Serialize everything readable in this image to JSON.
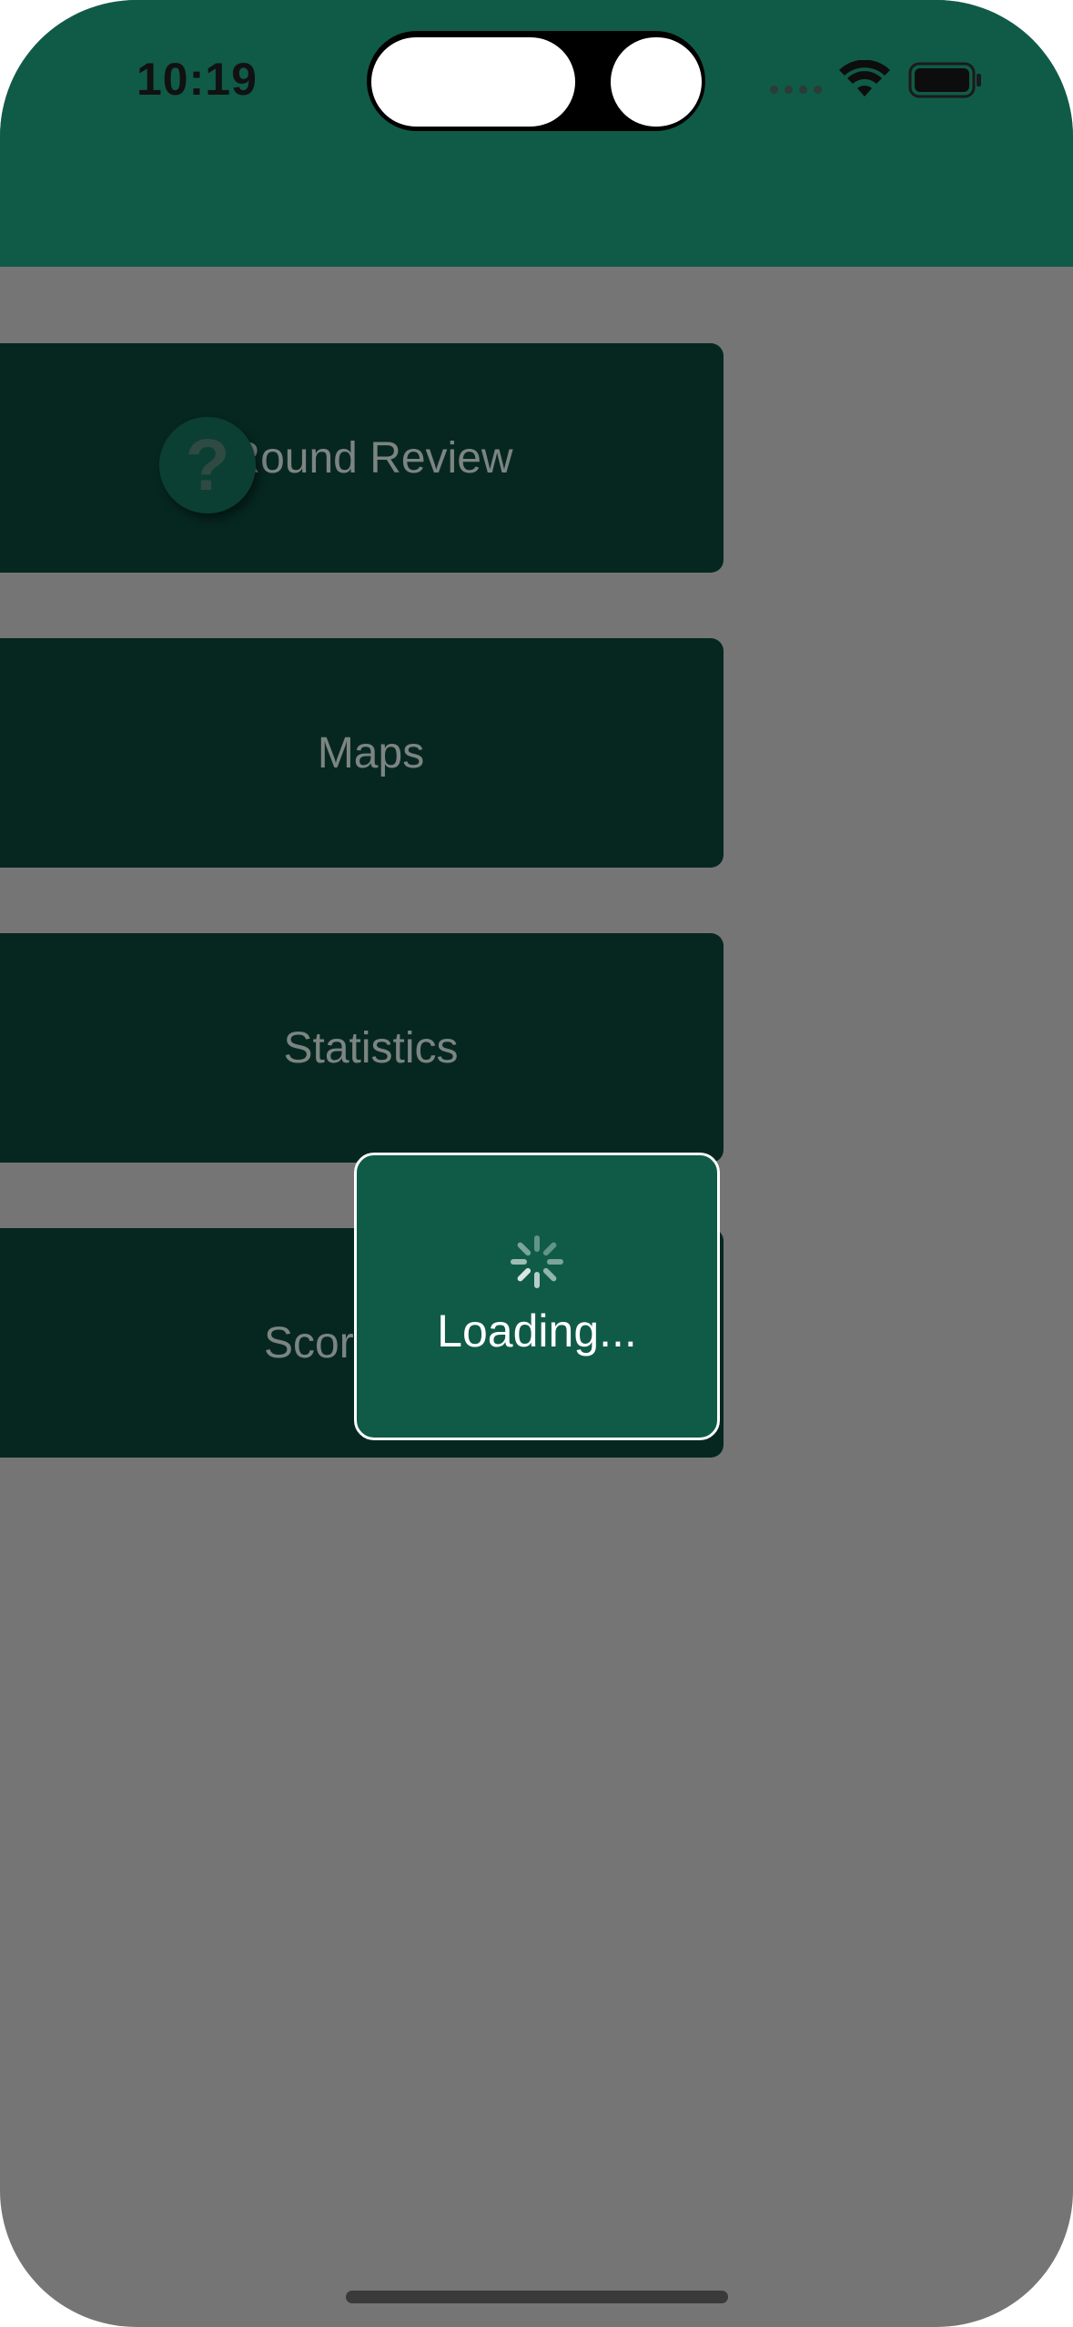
{
  "status_bar": {
    "time": "10:19"
  },
  "menu": {
    "items": [
      {
        "label": "Round Review"
      },
      {
        "label": "Maps"
      },
      {
        "label": "Statistics"
      },
      {
        "label": "Scor"
      }
    ]
  },
  "help_button": {
    "symbol": "?"
  },
  "loading": {
    "text": "Loading..."
  },
  "icons": {
    "wifi": "wifi-icon",
    "battery": "battery-icon",
    "spinner": "spinner-icon",
    "help": "question-mark-icon"
  },
  "colors": {
    "header": "#0f5b47",
    "overlay": "#757575",
    "button": "#062720",
    "loading_box": "#0f5b47"
  }
}
